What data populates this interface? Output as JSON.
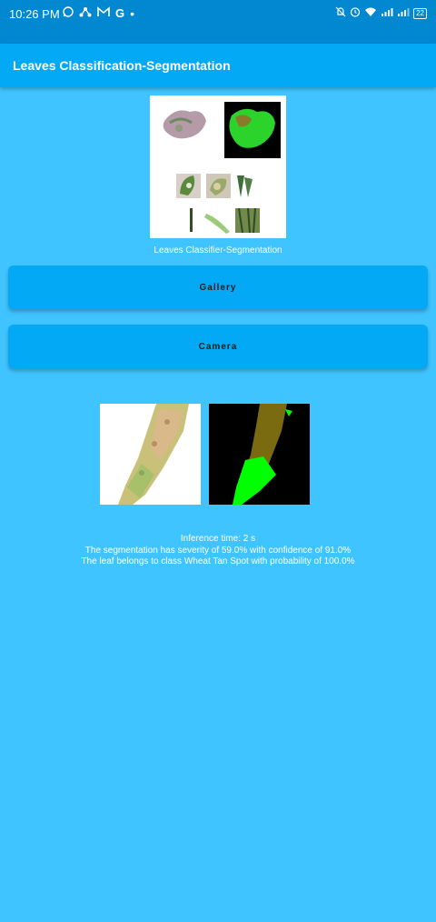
{
  "status_bar": {
    "time": "10:26 PM",
    "left_icons": [
      "whatsapp-icon",
      "network-icon",
      "gmail-icon",
      "google-icon",
      "dot-icon"
    ],
    "battery": "22"
  },
  "app_bar": {
    "title": "Leaves Classification-Segmentation"
  },
  "hero": {
    "caption": "Leaves Classifier-Segmentation"
  },
  "buttons": {
    "gallery": "Gallery",
    "camera": "Camera"
  },
  "results": {
    "inference": "Inference time: 2 s",
    "segmentation": "The segmentation has severity of 59.0% with confidence of 91.0%",
    "classification": "The leaf belongs to class  Wheat Tan Spot with probability of 100.0%"
  },
  "colors": {
    "background": "#40c4ff",
    "status_bar": "#0288d1",
    "app_bar": "#03a9f4",
    "button": "#03a9f4",
    "mask_healthy": "#00ff00",
    "mask_disease": "#7a6a10"
  }
}
